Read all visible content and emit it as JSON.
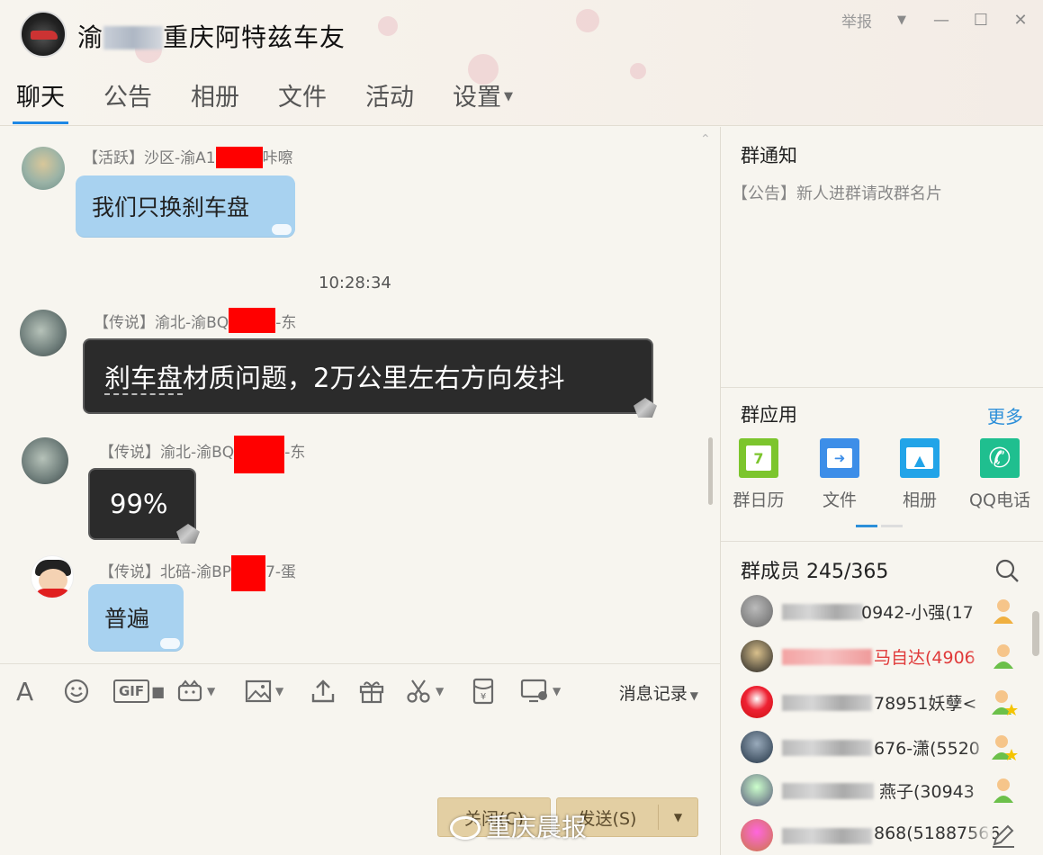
{
  "window": {
    "group_name_prefix": "渝",
    "group_name_suffix": "重庆阿特兹车友",
    "report_label": "举报",
    "menu_glyph": "▼",
    "minimize_glyph": "—",
    "maximize_glyph": "☐",
    "close_glyph": "✕"
  },
  "tabs": [
    {
      "label": "聊天",
      "active": true
    },
    {
      "label": "公告"
    },
    {
      "label": "相册"
    },
    {
      "label": "文件"
    },
    {
      "label": "活动"
    },
    {
      "label": "设置",
      "has_dropdown": true
    }
  ],
  "chat": {
    "timestamp": "10:28:34",
    "messages": [
      {
        "sender_prefix": "【活跃】沙区-渝A1",
        "sender_suffix": "咔嚓",
        "text": "我们只换刹车盘",
        "style": "blue"
      },
      {
        "sender_prefix": "【传说】渝北-渝BQ",
        "sender_suffix": "-东",
        "text_underlined": "刹车盘",
        "text_rest": "材质问题，2万公里左右方向发抖",
        "style": "dark"
      },
      {
        "sender_prefix": "【传说】渝北-渝BQ",
        "sender_suffix": "-东",
        "text": "99%",
        "style": "dark"
      },
      {
        "sender_prefix": "【传说】北碚-渝BP",
        "sender_suffix": "7-蛋",
        "text": "普遍",
        "style": "blue"
      }
    ]
  },
  "toolbar": {
    "font_icon": "A",
    "gif_label": "GIF",
    "history_label": "消息记录"
  },
  "buttons": {
    "close_label": "关闭(C)",
    "send_label": "发送(S)"
  },
  "watermark": "重庆晨报",
  "right_panel": {
    "notice_title": "群通知",
    "notice_text": "【公告】新人进群请改群名片",
    "apps_title": "群应用",
    "more_label": "更多",
    "apps": [
      {
        "label": "群日历",
        "icon": "calendar-icon",
        "color": "#7cc52d",
        "glyph": "7"
      },
      {
        "label": "文件",
        "icon": "folder-icon",
        "color": "#3d8ee8",
        "glyph": "➜"
      },
      {
        "label": "相册",
        "icon": "photo-icon",
        "color": "#22a4e8",
        "glyph": "▲"
      },
      {
        "label": "QQ电话",
        "icon": "phone-icon",
        "color": "#1fbf8f",
        "glyph": "✆"
      }
    ],
    "members_title": "群成员 245/365",
    "members": [
      {
        "name": "0942-小强(17",
        "red": false,
        "role": "member",
        "mask_w": 90
      },
      {
        "name": "马自达(4906",
        "red": true,
        "role": "member",
        "mask_w": 100
      },
      {
        "name": "78951妖孽<",
        "red": false,
        "role": "admin",
        "mask_w": 100
      },
      {
        "name": "676-潇(5520",
        "red": false,
        "role": "admin",
        "mask_w": 100
      },
      {
        "name": "燕子(30943",
        "red": false,
        "role": "member",
        "mask_w": 102
      },
      {
        "name": "868(51887566",
        "red": false,
        "role": "edit",
        "mask_w": 100
      }
    ]
  }
}
